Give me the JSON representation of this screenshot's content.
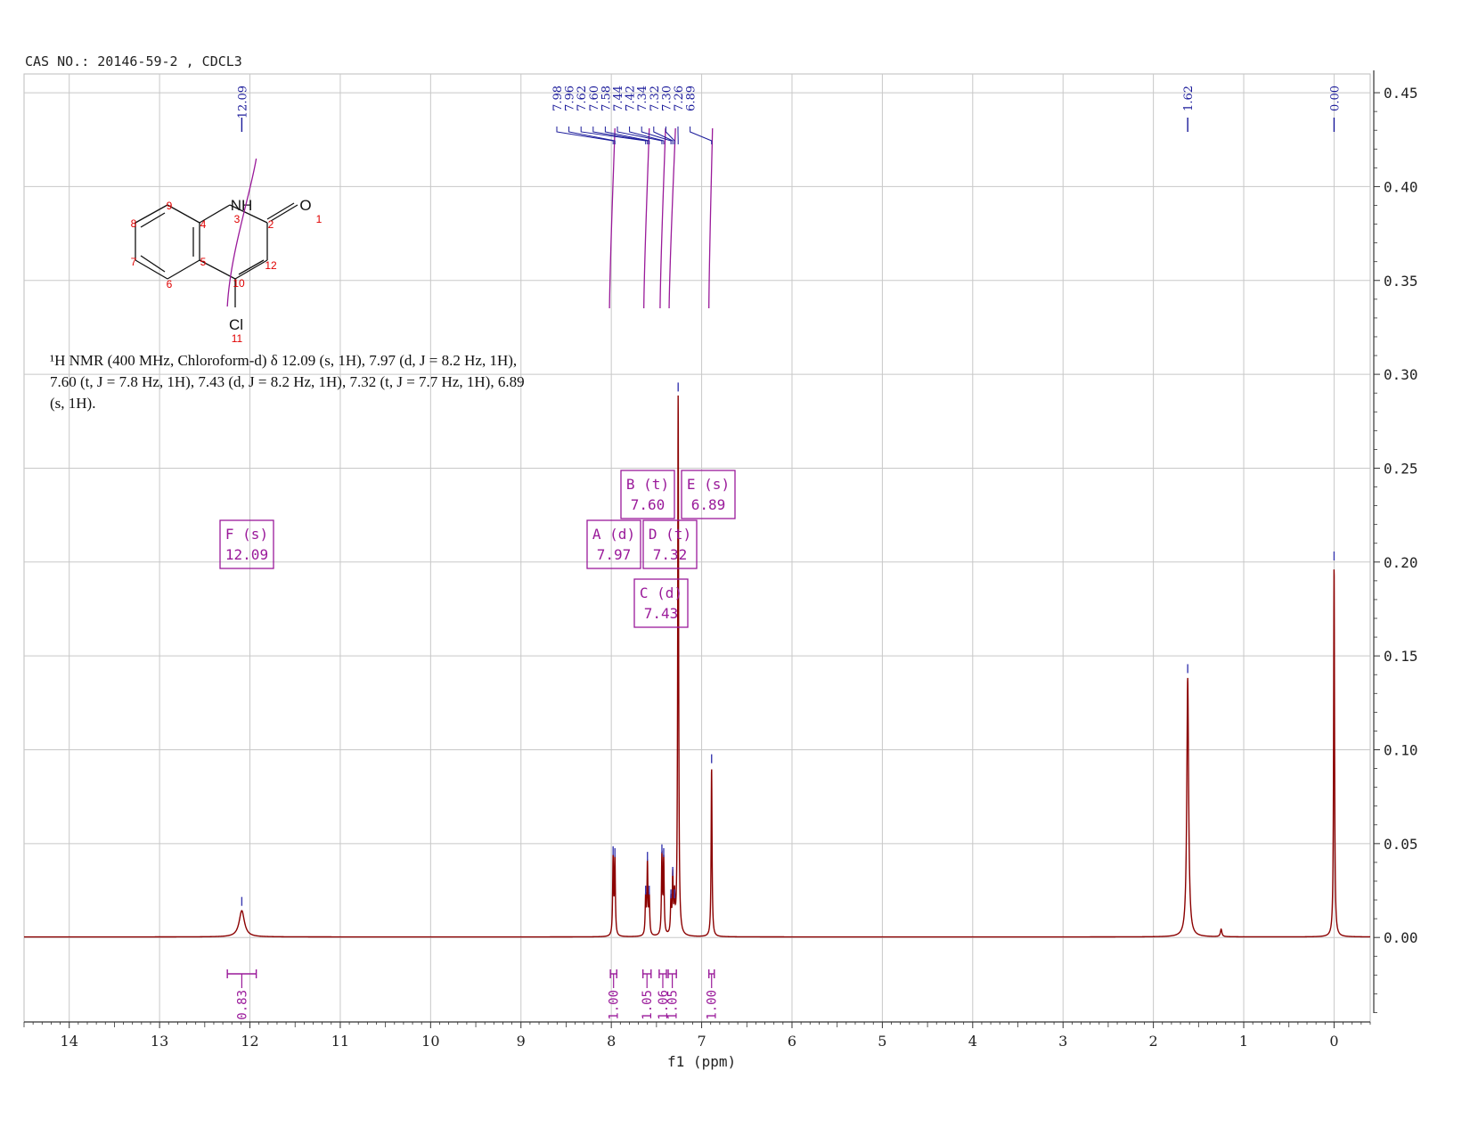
{
  "header": "CAS NO.: 20146-59-2 , CDCL3",
  "description": {
    "line1": "¹H NMR (400 MHz, Chloroform-d) δ 12.09 (s, 1H), 7.97 (d, J = 8.2 Hz, 1H),",
    "line2": "7.60 (t, J = 7.8 Hz, 1H), 7.43 (d, J = 8.2 Hz, 1H), 7.32 (t, J = 7.7 Hz, 1H), 6.89",
    "line3": "(s, 1H)."
  },
  "molecule": {
    "atoms": [
      "NH",
      "O",
      "Cl"
    ],
    "numbers": [
      "1",
      "2",
      "3",
      "4",
      "5",
      "6",
      "7",
      "8",
      "9",
      "10",
      "11",
      "12"
    ]
  },
  "colors": {
    "spectrum": "#8b0000",
    "peak_labels": "#1a1a9a",
    "integrals": "#9a1a9a",
    "atom_numbers": "#e00000",
    "grid": "#c8c8c8"
  },
  "chart_data": {
    "type": "line",
    "xlabel": "f1 (ppm)",
    "xlim": [
      14.5,
      -0.4
    ],
    "ylim": [
      -0.045,
      0.46
    ],
    "x_ticks": [
      "14",
      "13",
      "12",
      "11",
      "10",
      "9",
      "8",
      "7",
      "6",
      "5",
      "4",
      "3",
      "2",
      "1",
      "0"
    ],
    "y_ticks": [
      "0.45",
      "0.40",
      "0.35",
      "0.30",
      "0.25",
      "0.20",
      "0.15",
      "0.10",
      "0.05",
      "0.00"
    ],
    "grid": true,
    "peaks": [
      {
        "ppm": 12.09,
        "height": 0.014,
        "width": 0.035
      },
      {
        "ppm": 7.98,
        "height": 0.041,
        "width": 0.006
      },
      {
        "ppm": 7.96,
        "height": 0.04,
        "width": 0.006
      },
      {
        "ppm": 7.62,
        "height": 0.02,
        "width": 0.006
      },
      {
        "ppm": 7.6,
        "height": 0.038,
        "width": 0.006
      },
      {
        "ppm": 7.58,
        "height": 0.02,
        "width": 0.006
      },
      {
        "ppm": 7.44,
        "height": 0.042,
        "width": 0.006
      },
      {
        "ppm": 7.42,
        "height": 0.04,
        "width": 0.006
      },
      {
        "ppm": 7.34,
        "height": 0.018,
        "width": 0.006
      },
      {
        "ppm": 7.32,
        "height": 0.03,
        "width": 0.006
      },
      {
        "ppm": 7.3,
        "height": 0.018,
        "width": 0.006
      },
      {
        "ppm": 7.26,
        "height": 0.288,
        "width": 0.006
      },
      {
        "ppm": 6.89,
        "height": 0.09,
        "width": 0.006
      },
      {
        "ppm": 1.62,
        "height": 0.138,
        "width": 0.012
      },
      {
        "ppm": 1.25,
        "height": 0.004,
        "width": 0.01
      },
      {
        "ppm": 0.0,
        "height": 0.198,
        "width": 0.006
      }
    ],
    "peak_labels_top": [
      "7.98",
      "7.96",
      "7.62",
      "7.60",
      "7.58",
      "7.44",
      "7.42",
      "7.34",
      "7.32",
      "7.30",
      "7.26",
      "6.89"
    ],
    "peak_labels_single": [
      {
        "label": "12.09",
        "ppm": 12.09
      },
      {
        "label": "1.62",
        "ppm": 1.62
      },
      {
        "label": "0.00",
        "ppm": 0.0
      }
    ],
    "multiplets": [
      {
        "name": "F (s)",
        "shift": "12.09"
      },
      {
        "name": "B (t)",
        "shift": "7.60"
      },
      {
        "name": "E (s)",
        "shift": "6.89"
      },
      {
        "name": "A (d)",
        "shift": "7.97"
      },
      {
        "name": "D (t)",
        "shift": "7.32"
      },
      {
        "name": "C (d)",
        "shift": "7.43"
      }
    ],
    "integrals": [
      {
        "value": "0.83",
        "from": 12.25,
        "to": 11.93
      },
      {
        "value": "1.00",
        "from": 8.01,
        "to": 7.94
      },
      {
        "value": "1.05",
        "from": 7.65,
        "to": 7.56
      },
      {
        "value": "1.06",
        "from": 7.47,
        "to": 7.39
      },
      {
        "value": "1.05",
        "from": 7.37,
        "to": 7.28
      },
      {
        "value": "1.00",
        "from": 6.92,
        "to": 6.86
      }
    ]
  }
}
